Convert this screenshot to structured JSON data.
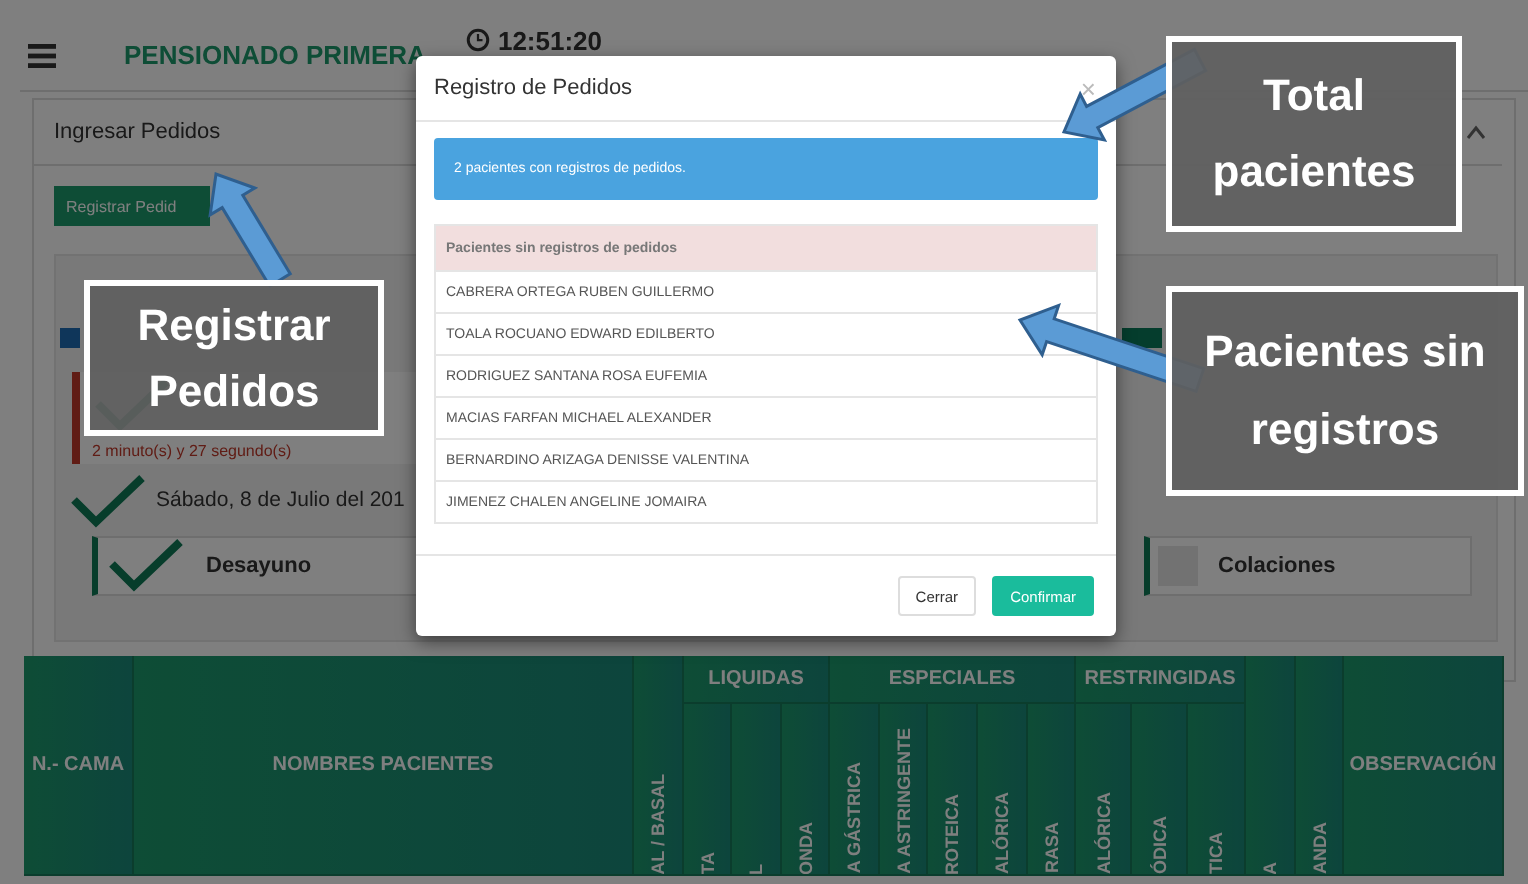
{
  "header": {
    "title": "PENSIONADO PRIMERA",
    "time": "12:51:20"
  },
  "panel": {
    "title": "Ingresar Pedidos",
    "button": "Registrar Pedid",
    "timer": "2 minuto(s) y 27 segundo(s)",
    "date": "Sábado, 8 de Julio del 201",
    "meals": [
      {
        "label": "Desayuno",
        "checked": true
      },
      {
        "label": "Colaciones",
        "checked": false
      }
    ]
  },
  "table": {
    "columns": [
      {
        "kind": "wide",
        "label": "N.- CAMA"
      },
      {
        "kind": "wide",
        "label": "NOMBRES PACIENTES"
      },
      {
        "kind": "vertical",
        "label": "AL / BASAL"
      },
      {
        "kind": "group",
        "label": "LIQUIDAS",
        "children": [
          "TA",
          "L",
          "ONDA"
        ]
      },
      {
        "kind": "group",
        "label": "ESPECIALES",
        "children": [
          "A GÁSTRICA",
          "A ASTRINGENTE",
          "ROTEICA",
          "ALÓRICA",
          "RASA"
        ]
      },
      {
        "kind": "group",
        "label": "RESTRINGIDAS",
        "children": [
          "ALÓRICA",
          "ÓDICA",
          "TICA"
        ]
      },
      {
        "kind": "vertical",
        "label": "A"
      },
      {
        "kind": "vertical",
        "label": "ANDA"
      },
      {
        "kind": "wide",
        "label": "OBSERVACIÓN"
      }
    ]
  },
  "modal": {
    "title": "Registro de Pedidos",
    "close": "×",
    "alert": "2 pacientes con registros de pedidos.",
    "list_title": "Pacientes sin registros de pedidos",
    "patients": [
      "CABRERA ORTEGA RUBEN GUILLERMO",
      "TOALA ROCUANO EDWARD EDILBERTO",
      "RODRIGUEZ SANTANA ROSA EUFEMIA",
      "MACIAS FARFAN MICHAEL ALEXANDER",
      "BERNARDINO ARIZAGA DENISSE VALENTINA",
      "JIMENEZ CHALEN ANGELINE JOMAIRA"
    ],
    "buttons": [
      {
        "label": "Cerrar",
        "kind": "default"
      },
      {
        "label": "Confirmar",
        "kind": "primary"
      }
    ]
  },
  "callouts": [
    "Total pacientes",
    "Registrar Pedidos",
    "Pacientes sin registros"
  ]
}
